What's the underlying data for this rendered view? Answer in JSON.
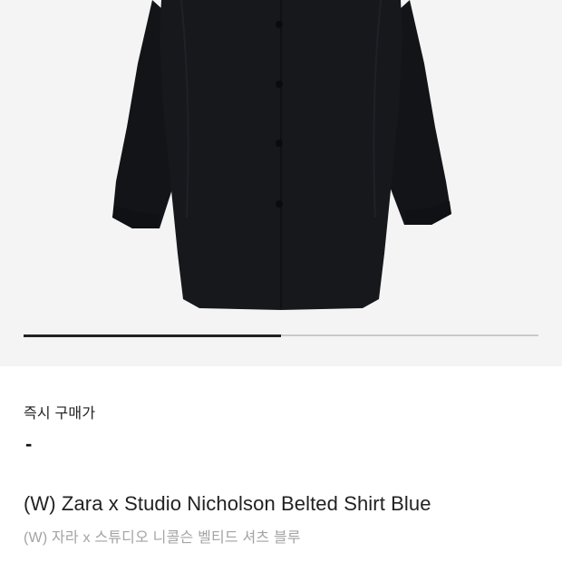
{
  "product": {
    "image_alt": "Black belted shirt",
    "gallery_progress": 0.5
  },
  "price": {
    "label": "즉시 구매가",
    "value": "-"
  },
  "name": {
    "en": "(W) Zara x Studio Nicholson Belted Shirt Blue",
    "ko": "(W) 자라 x 스튜디오 니콜슨 벨티드 셔츠 블루"
  },
  "colors": {
    "image_background": "#f4f4f4",
    "shirt": "#14161a",
    "progress_track": "#c9c9c9",
    "progress_fill": "#222222",
    "secondary_text": "#a3a3a3"
  }
}
